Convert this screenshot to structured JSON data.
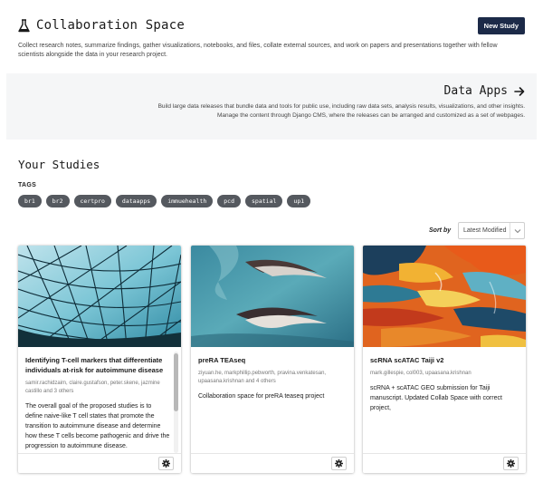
{
  "header": {
    "title": "Collaboration Space",
    "new_study_label": "New Study",
    "intro": "Collect research notes, summarize findings, gather visualizations, notebooks, and files, collate external sources, and work on papers and presentations together with fellow scientists alongside the data in your research project."
  },
  "data_apps": {
    "title": "Data Apps",
    "line1": "Build large data releases that bundle data and tools for public use, including raw data sets, analysis results, visualizations, and other insights.",
    "line2": "Manage the content through Django CMS, where the releases can be arranged and customized as a set of webpages."
  },
  "studies": {
    "heading": "Your Studies",
    "tags_label": "TAGS",
    "tags": [
      "br1",
      "br2",
      "certpro",
      "dataapps",
      "immuehealth",
      "pcd",
      "spatial",
      "up1"
    ],
    "sort_label": "Sort by",
    "sort_value": "Latest Modified",
    "cards": [
      {
        "title": "Identifying T-cell markers that differentiate individuals at-risk for autoimmune disease",
        "authors": "samir.rachidzaim, claire.gustafson, peter.skene, jazmine castillo and 3 others",
        "description": "The overall goal of the proposed studies is to define naive-like T cell states that promote the transition to autoimmune disease and determine how these T cells become pathogenic and drive the progression to autoimmune disease."
      },
      {
        "title": "preRA TEAseq",
        "authors": "ziyuan.he, markphillip.pebworth, pravina.venkatesan, upaasana.krishnan and 4 others",
        "description": "Collaboration space for preRA teaseq project"
      },
      {
        "title": "scRNA scATAC Taiji v2",
        "authors": "mark.gillespie, col003, upaasana.krishnan",
        "description": "scRNA + scATAC GEO submission for Taiji manuscript. Updated Collab Space with correct project,"
      }
    ]
  },
  "colors": {
    "primary_button": "#1c2a48",
    "tag_bg": "#55595f",
    "banner_bg": "#f5f6f7"
  },
  "icons": {
    "title": "flask-icon",
    "data_apps": "arrow-right-icon",
    "sort": "chevron-down-icon",
    "card_action": "gear-icon"
  }
}
